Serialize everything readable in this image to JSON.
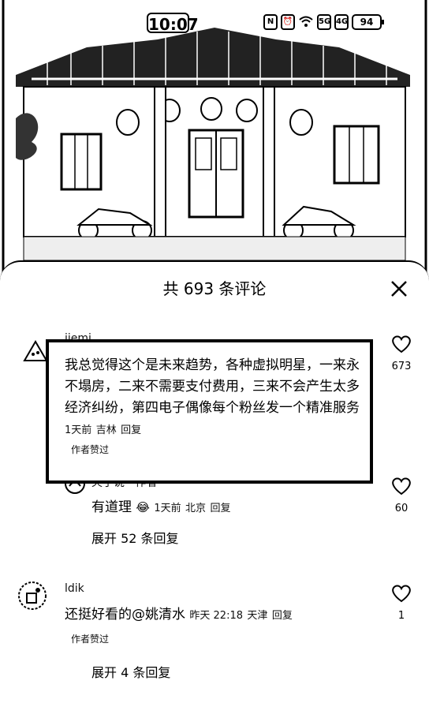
{
  "status_bar": {
    "time": "10:07",
    "icons": [
      "nfc-icon",
      "alarm-icon",
      "wifi-icon",
      "5g-icon",
      "4g-icon"
    ],
    "icon_labels": [
      "N",
      "⏰",
      "",
      "5G",
      "4G"
    ],
    "battery": "94"
  },
  "sheet": {
    "title": "共 693 条评论"
  },
  "comments": [
    {
      "username": "jiemi",
      "text": "我总觉得这个是未来趋势，各种虚拟明星，一来永不塌房，二来不需要支付费用，三来不会产生太多经济纠纷，第四电子偶像每个粉丝发一个精准服务",
      "time": "1天前",
      "location": "吉林",
      "reply_label": "回复",
      "author_liked": "作者赞过",
      "likes": "673",
      "reply": {
        "username": "夫子说 · 作者",
        "text": "有道理",
        "emoji": "😂",
        "time": "1天前",
        "location": "北京",
        "reply_label": "回复",
        "likes": "60"
      },
      "expand": "展开 52 条回复"
    },
    {
      "username": "ldik",
      "text": "还挺好看的@姚清水",
      "time": "昨天 22:18",
      "location": "天津",
      "reply_label": "回复",
      "author_liked": "作者赞过",
      "likes": "1",
      "expand": "展开 4 条回复"
    }
  ]
}
